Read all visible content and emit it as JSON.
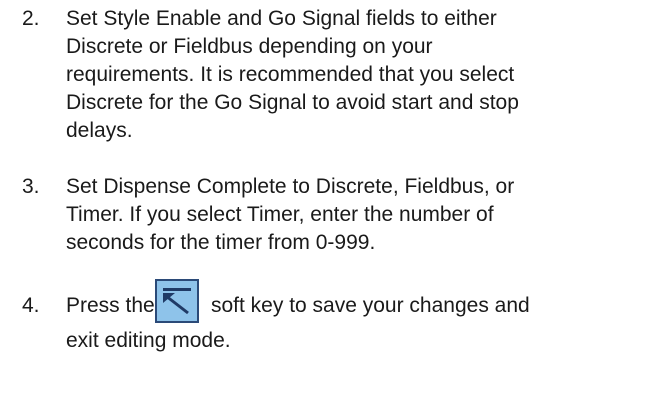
{
  "steps": [
    {
      "number": "2.",
      "lines": [
        "Set Style Enable and Go Signal fields to either",
        "Discrete or Fieldbus depending on your",
        "requirements. It is recommended that you select",
        "Discrete for the Go Signal to avoid start and stop",
        "delays."
      ]
    },
    {
      "number": "3.",
      "lines": [
        "Set Dispense Complete to Discrete, Fieldbus, or",
        "Timer. If you select Timer, enter the number of",
        "seconds for the timer from 0-999."
      ]
    },
    {
      "number": "4.",
      "before_icon": "Press the",
      "after_icon": "soft key to save your changes and",
      "line2": "exit editing mode.",
      "icon": "save-exit-softkey-icon"
    }
  ],
  "colors": {
    "text": "#1a1a1a",
    "softkey_fill": "#8ec3ea",
    "softkey_border": "#2b4a78",
    "softkey_glyph": "#1f3a66"
  }
}
